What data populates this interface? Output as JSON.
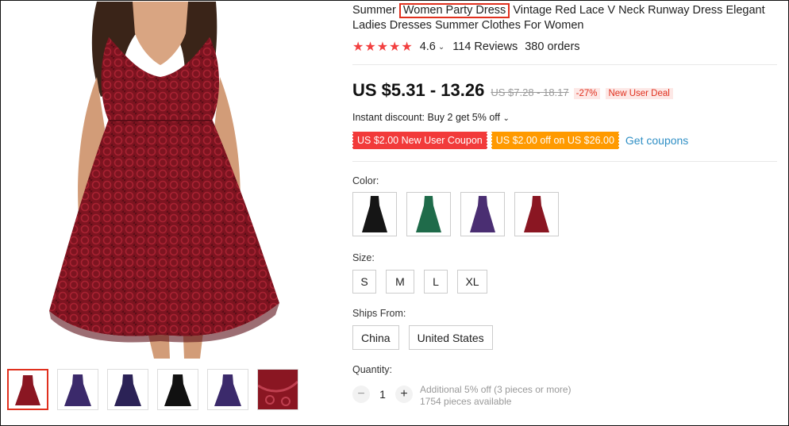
{
  "product": {
    "title_before": "Summer ",
    "title_highlight": "Women Party Dress",
    "title_after": " Vintage Red Lace V Neck Runway Dress Elegant Ladies Dresses Summer Clothes For Women",
    "rating_stars": "★★★★★",
    "rating_value": "4.6",
    "reviews": "114 Reviews",
    "orders": "380 orders"
  },
  "pricing": {
    "price": "US $5.31 - 13.26",
    "original_price": "US $7.28 - 18.17",
    "discount_pct": "-27%",
    "deal_badge": "New User Deal",
    "instant_discount": "Instant discount: Buy 2 get 5% off",
    "coupons": [
      "US $2.00 New User Coupon",
      "US $2.00 off on US $26.00"
    ],
    "get_coupons": "Get coupons"
  },
  "options": {
    "color_label": "Color:",
    "colors": [
      {
        "name": "black",
        "hex": "#151515"
      },
      {
        "name": "green",
        "hex": "#1f6b4a"
      },
      {
        "name": "purple",
        "hex": "#4a2e72"
      },
      {
        "name": "red",
        "hex": "#8a1622"
      }
    ],
    "size_label": "Size:",
    "sizes": [
      "S",
      "M",
      "L",
      "XL"
    ],
    "ships_label": "Ships From:",
    "ships": [
      "China",
      "United States"
    ],
    "quantity_label": "Quantity:",
    "quantity": "1",
    "qty_minus": "−",
    "qty_plus": "+",
    "qty_note_1": "Additional 5% off (3 pieces or more)",
    "qty_note_2": "1754 pieces available"
  },
  "gallery": {
    "thumb_colors": [
      "#8a1622",
      "#3b2a6b",
      "#2b2256",
      "#111111",
      "#3b2a6b",
      "#8a1622"
    ]
  },
  "colors": {
    "accent_red": "#e0301e",
    "star_red": "#f24040",
    "link_blue": "#2f8fc5"
  }
}
